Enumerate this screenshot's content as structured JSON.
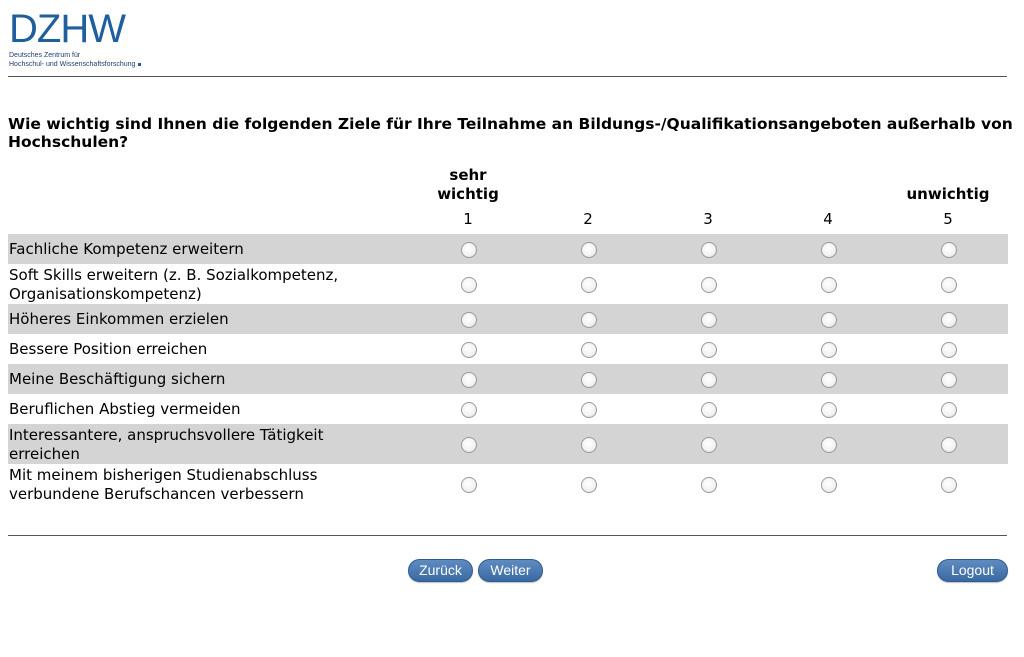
{
  "logo": {
    "word": "DZHW",
    "line1": "Deutsches Zentrum für",
    "line2": "Hochschul- und Wissenschaftsforschung"
  },
  "question": "Wie wichtig sind Ihnen die folgenden Ziele für Ihre Teilnahme an Bildungs-/Qualifikationsangeboten außerhalb von Hochschulen?",
  "scale": {
    "left_label_1": "sehr",
    "left_label_2": "wichtig",
    "right_label": "unwichtig",
    "numbers": [
      "1",
      "2",
      "3",
      "4",
      "5"
    ]
  },
  "items": [
    {
      "label_1": "Fachliche Kompetenz erweitern",
      "label_2": ""
    },
    {
      "label_1": "Soft Skills erweitern (z. B. Sozialkompetenz,",
      "label_2": "Organisationskompetenz)"
    },
    {
      "label_1": "Höheres Einkommen erzielen",
      "label_2": ""
    },
    {
      "label_1": "Bessere Position erreichen",
      "label_2": ""
    },
    {
      "label_1": "Meine Beschäftigung sichern",
      "label_2": ""
    },
    {
      "label_1": "Beruflichen Abstieg vermeiden",
      "label_2": ""
    },
    {
      "label_1": "Interessantere, anspruchsvollere Tätigkeit",
      "label_2": "erreichen"
    },
    {
      "label_1": "Mit meinem bisherigen Studienabschluss",
      "label_2": "verbundene Berufschancen verbessern"
    }
  ],
  "buttons": {
    "back": "Zurück",
    "next": "Weiter",
    "logout": "Logout"
  },
  "colors": {
    "brand": "#1f5f9e",
    "shaded_row": "#d4d4d4",
    "button": "#3a6aa3"
  }
}
